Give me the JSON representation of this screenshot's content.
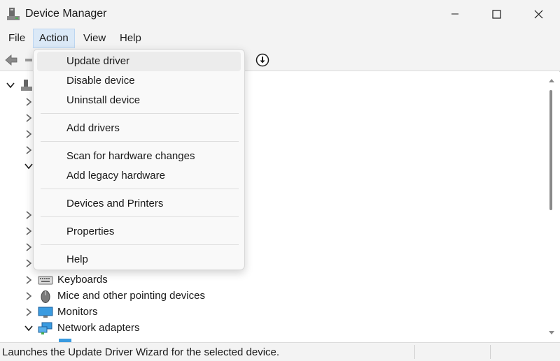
{
  "window": {
    "title": "Device Manager"
  },
  "menubar": {
    "file": "File",
    "action": "Action",
    "view": "View",
    "help": "Help"
  },
  "action_menu": {
    "items": [
      {
        "label": "Update driver",
        "highlighted": true
      },
      {
        "label": "Disable device"
      },
      {
        "label": "Uninstall device"
      },
      {
        "label": "Add drivers"
      },
      {
        "label": "Scan for hardware changes"
      },
      {
        "label": "Add legacy hardware"
      },
      {
        "label": "Devices and Printers"
      },
      {
        "label": "Properties"
      },
      {
        "label": "Help"
      }
    ]
  },
  "tree": {
    "visible_items": [
      {
        "label": "Keyboards",
        "expanded": false,
        "icon": "keyboard-icon"
      },
      {
        "label": "Mice and other pointing devices",
        "expanded": false,
        "icon": "mouse-icon"
      },
      {
        "label": "Monitors",
        "expanded": false,
        "icon": "monitor-icon"
      },
      {
        "label": "Network adapters",
        "expanded": true,
        "icon": "network-adapter-icon"
      }
    ]
  },
  "statusbar": {
    "text": "Launches the Update Driver Wizard for the selected device."
  },
  "colors": {
    "menu_highlight": "#dbe9f7",
    "accent": "#0067c0"
  }
}
